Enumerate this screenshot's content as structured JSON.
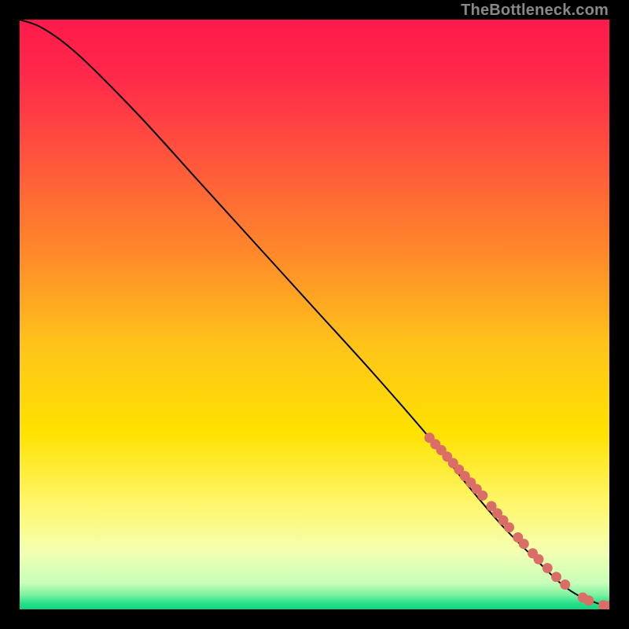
{
  "watermark": "TheBottleneck.com",
  "chart_data": {
    "type": "line",
    "title": "",
    "xlabel": "",
    "ylabel": "",
    "xlim": [
      0,
      100
    ],
    "ylim": [
      0,
      100
    ],
    "gradient_stops": [
      {
        "offset": 0.0,
        "color": "#ff1a4b"
      },
      {
        "offset": 0.1,
        "color": "#ff2a4a"
      },
      {
        "offset": 0.25,
        "color": "#ff5a3a"
      },
      {
        "offset": 0.4,
        "color": "#ff8a2a"
      },
      {
        "offset": 0.55,
        "color": "#ffc31a"
      },
      {
        "offset": 0.7,
        "color": "#fee200"
      },
      {
        "offset": 0.82,
        "color": "#fff66a"
      },
      {
        "offset": 0.9,
        "color": "#f5ffb0"
      },
      {
        "offset": 0.955,
        "color": "#c8ffba"
      },
      {
        "offset": 0.975,
        "color": "#7ef2a0"
      },
      {
        "offset": 0.99,
        "color": "#25e08a"
      },
      {
        "offset": 1.0,
        "color": "#16d27f"
      }
    ],
    "series": [
      {
        "name": "curve",
        "x": [
          0,
          4,
          10,
          20,
          30,
          40,
          50,
          60,
          70,
          76,
          82,
          88,
          92,
          95,
          97.5,
          99,
          100
        ],
        "y": [
          100,
          98.5,
          94,
          84,
          73,
          62,
          51,
          40,
          28.5,
          21,
          14,
          8,
          4.2,
          2.2,
          1.2,
          0.7,
          0.6
        ]
      }
    ],
    "markers": [
      {
        "x": 69.5,
        "y": 29.1
      },
      {
        "x": 70.5,
        "y": 28.0
      },
      {
        "x": 71.5,
        "y": 27.0
      },
      {
        "x": 72.5,
        "y": 25.9
      },
      {
        "x": 73.5,
        "y": 24.8
      },
      {
        "x": 74.5,
        "y": 23.7
      },
      {
        "x": 75.5,
        "y": 22.6
      },
      {
        "x": 76.5,
        "y": 21.5
      },
      {
        "x": 77.5,
        "y": 20.4
      },
      {
        "x": 78.5,
        "y": 19.3
      },
      {
        "x": 80.0,
        "y": 17.5
      },
      {
        "x": 81.0,
        "y": 16.3
      },
      {
        "x": 82.0,
        "y": 15.1
      },
      {
        "x": 83.0,
        "y": 13.9
      },
      {
        "x": 84.5,
        "y": 12.2
      },
      {
        "x": 85.5,
        "y": 11.1
      },
      {
        "x": 87.0,
        "y": 9.5
      },
      {
        "x": 88.0,
        "y": 8.5
      },
      {
        "x": 89.5,
        "y": 7.0
      },
      {
        "x": 91.0,
        "y": 5.5
      },
      {
        "x": 92.5,
        "y": 4.2
      },
      {
        "x": 95.5,
        "y": 2.0
      },
      {
        "x": 96.5,
        "y": 1.5
      },
      {
        "x": 99.0,
        "y": 0.7
      },
      {
        "x": 100.0,
        "y": 0.6
      }
    ],
    "marker_style": {
      "r": 6.5,
      "fill": "#da6e67"
    },
    "line_style": {
      "stroke": "#000000",
      "width": 2
    }
  }
}
